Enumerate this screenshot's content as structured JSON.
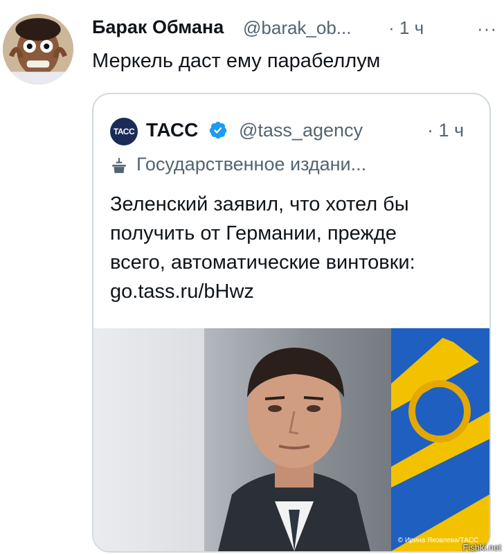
{
  "tweet": {
    "author_name": "Барак Обмана",
    "handle": "@barak_ob...",
    "time": "· 1 ч",
    "more": "···",
    "text": "Меркель даст ему парабеллум"
  },
  "quoted_tweet": {
    "logo_text": "ТАСС",
    "author_name": "ТАСС",
    "handle": "@tass_agency",
    "time": "· 1 ч",
    "label": "Государственное издани...",
    "text_lines": [
      "Зеленский заявил, что хотел бы",
      "получить от Германии, прежде",
      "всего, автоматические винтовки:",
      "go.tass.ru/bHwz"
    ],
    "photo_credit": "© Ирина Яковлева/ТАСС"
  },
  "watermark": "Fishki.net",
  "colors": {
    "verified": "#1d9bf0",
    "secondary_text": "#536471",
    "border": "#cfd9de"
  }
}
